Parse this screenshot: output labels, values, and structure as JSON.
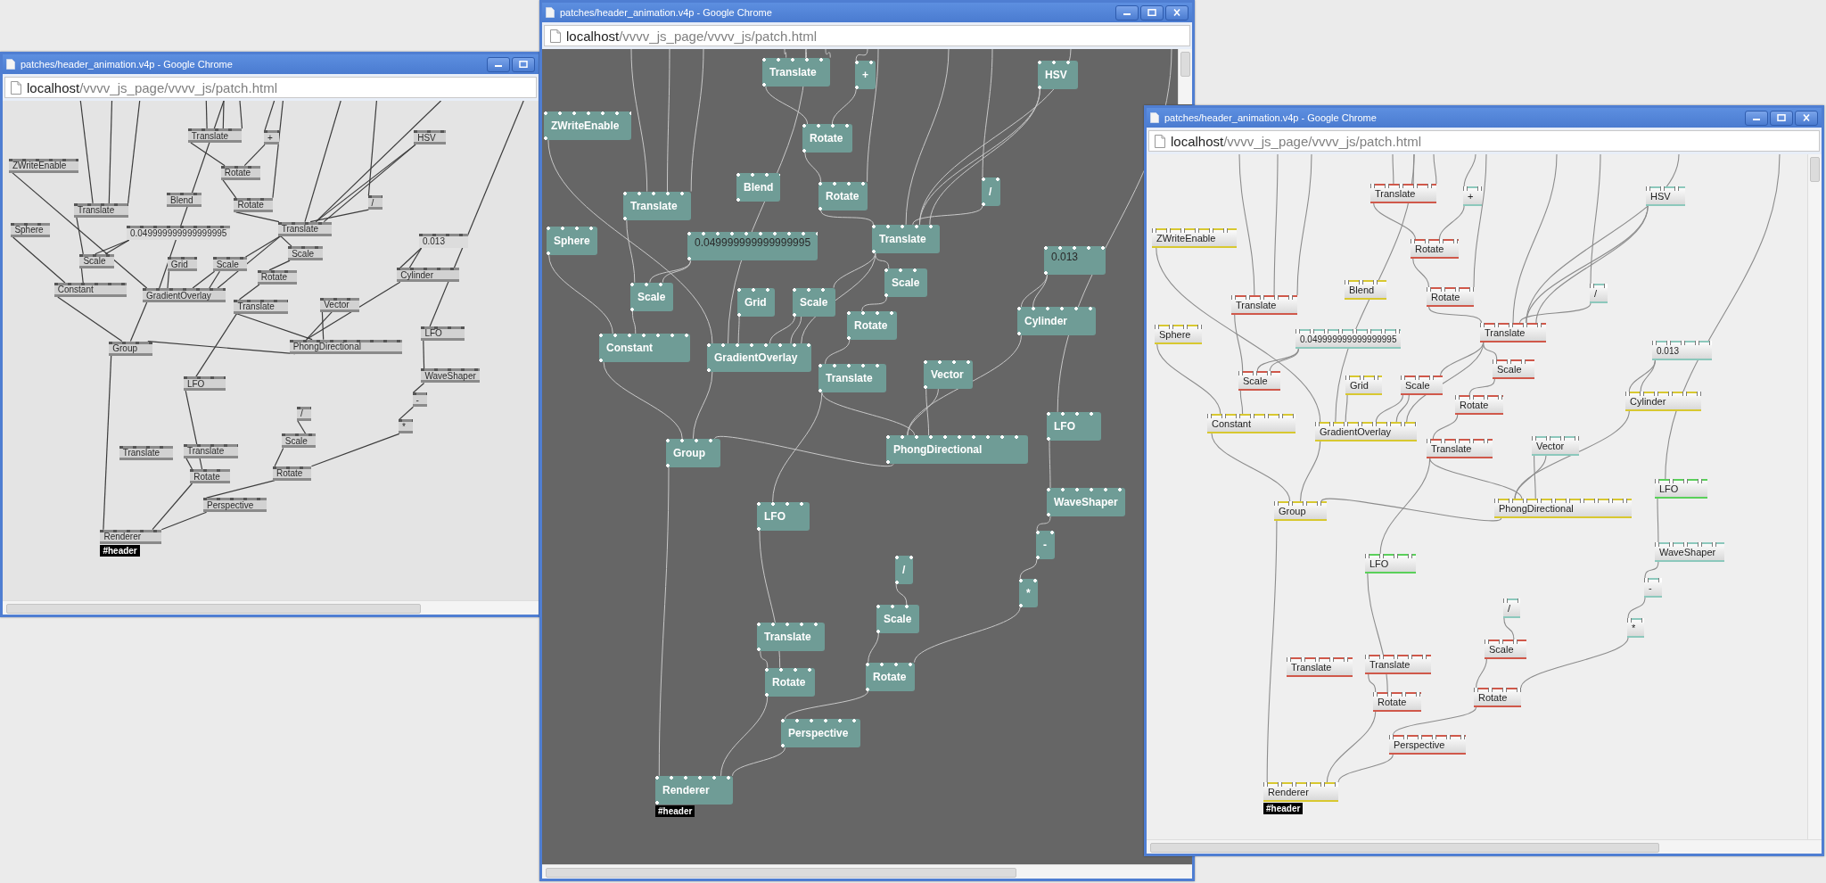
{
  "windows": [
    {
      "kind": "gray",
      "title": "patches/header_animation.v4p - Google Chrome",
      "controls": [
        {
          "kind": "minimize"
        },
        {
          "kind": "maximize"
        }
      ],
      "url": {
        "host": "localhost",
        "path": "/vvvv_js_page/vvvv_js/patch.html"
      },
      "nodes": [
        {
          "label": "Translate",
          "kind": "op"
        },
        {
          "label": "+",
          "kind": "op"
        },
        {
          "label": "HSV",
          "kind": "op"
        },
        {
          "label": "ZWriteEnable",
          "kind": "op"
        },
        {
          "label": "Rotate",
          "kind": "op"
        },
        {
          "label": "Blend",
          "kind": "op"
        },
        {
          "label": "Translate",
          "kind": "op"
        },
        {
          "label": "Rotate",
          "kind": "op"
        },
        {
          "label": "/",
          "kind": "op"
        },
        {
          "label": "Sphere",
          "kind": "op"
        },
        {
          "label": "0.049999999999999995",
          "kind": "value"
        },
        {
          "label": "Translate",
          "kind": "op"
        },
        {
          "label": "0.013",
          "kind": "value"
        },
        {
          "label": "Scale",
          "kind": "op"
        },
        {
          "label": "Grid",
          "kind": "op"
        },
        {
          "label": "Scale",
          "kind": "op"
        },
        {
          "label": "Scale",
          "kind": "op"
        },
        {
          "label": "Cylinder",
          "kind": "op"
        },
        {
          "label": "Rotate",
          "kind": "op"
        },
        {
          "label": "Constant",
          "kind": "op"
        },
        {
          "label": "GradientOverlay",
          "kind": "op"
        },
        {
          "label": "Translate",
          "kind": "op"
        },
        {
          "label": "Vector",
          "kind": "op"
        },
        {
          "label": "LFO",
          "kind": "op"
        },
        {
          "label": "Group",
          "kind": "op"
        },
        {
          "label": "PhongDirectional",
          "kind": "op"
        },
        {
          "label": "WaveShaper",
          "kind": "op"
        },
        {
          "label": "LFO",
          "kind": "op"
        },
        {
          "label": "-",
          "kind": "op"
        },
        {
          "label": "/",
          "kind": "op"
        },
        {
          "label": "*",
          "kind": "op"
        },
        {
          "label": "Scale",
          "kind": "op"
        },
        {
          "label": "Translate",
          "kind": "op"
        },
        {
          "label": "Translate",
          "kind": "op"
        },
        {
          "label": "Rotate",
          "kind": "op"
        },
        {
          "label": "Rotate",
          "kind": "op"
        },
        {
          "label": "Perspective",
          "kind": "op"
        },
        {
          "label": "Renderer",
          "kind": "op",
          "tag": "#header"
        }
      ]
    },
    {
      "kind": "dark",
      "title": "patches/header_animation.v4p - Google Chrome",
      "controls": [
        {
          "kind": "minimize"
        },
        {
          "kind": "maximize"
        },
        {
          "kind": "close"
        }
      ],
      "url": {
        "host": "localhost",
        "path": "/vvvv_js_page/vvvv_js/patch.html"
      },
      "nodes": [
        {
          "label": "Translate",
          "kind": "op"
        },
        {
          "label": "+",
          "kind": "op"
        },
        {
          "label": "HSV",
          "kind": "op"
        },
        {
          "label": "ZWriteEnable",
          "kind": "op"
        },
        {
          "label": "Rotate",
          "kind": "op"
        },
        {
          "label": "Blend",
          "kind": "op"
        },
        {
          "label": "Translate",
          "kind": "op"
        },
        {
          "label": "Rotate",
          "kind": "op"
        },
        {
          "label": "/",
          "kind": "op"
        },
        {
          "label": "Sphere",
          "kind": "op"
        },
        {
          "label": "0.049999999999999995",
          "kind": "value"
        },
        {
          "label": "Translate",
          "kind": "op"
        },
        {
          "label": "0.013",
          "kind": "value"
        },
        {
          "label": "Scale",
          "kind": "op"
        },
        {
          "label": "Grid",
          "kind": "op"
        },
        {
          "label": "Scale",
          "kind": "op"
        },
        {
          "label": "Scale",
          "kind": "op"
        },
        {
          "label": "Cylinder",
          "kind": "op"
        },
        {
          "label": "Rotate",
          "kind": "op"
        },
        {
          "label": "Constant",
          "kind": "op"
        },
        {
          "label": "GradientOverlay",
          "kind": "op"
        },
        {
          "label": "Translate",
          "kind": "op"
        },
        {
          "label": "Vector",
          "kind": "op"
        },
        {
          "label": "LFO",
          "kind": "op"
        },
        {
          "label": "Group",
          "kind": "op"
        },
        {
          "label": "PhongDirectional",
          "kind": "op"
        },
        {
          "label": "WaveShaper",
          "kind": "op"
        },
        {
          "label": "LFO",
          "kind": "op"
        },
        {
          "label": "-",
          "kind": "op"
        },
        {
          "label": "/",
          "kind": "op"
        },
        {
          "label": "*",
          "kind": "op"
        },
        {
          "label": "Scale",
          "kind": "op"
        },
        {
          "label": "Translate",
          "kind": "op"
        },
        {
          "label": "Rotate",
          "kind": "op"
        },
        {
          "label": "Rotate",
          "kind": "op"
        },
        {
          "label": "Perspective",
          "kind": "op"
        },
        {
          "label": "Renderer",
          "kind": "op",
          "tag": "#header"
        }
      ]
    },
    {
      "kind": "light",
      "title": "patches/header_animation.v4p - Google Chrome",
      "controls": [
        {
          "kind": "minimize"
        },
        {
          "kind": "maximize"
        },
        {
          "kind": "close"
        }
      ],
      "url": {
        "host": "localhost",
        "path": "/vvvv_js_page/vvvv_js/patch.html"
      },
      "nodes": [
        {
          "label": "Translate",
          "kind": "op",
          "color": "#d0584a"
        },
        {
          "label": "+",
          "kind": "op",
          "color": "#8cc8bc"
        },
        {
          "label": "HSV",
          "kind": "op",
          "color": "#8cc8bc"
        },
        {
          "label": "ZWriteEnable",
          "kind": "op",
          "color": "#d8c830"
        },
        {
          "label": "Rotate",
          "kind": "op",
          "color": "#d0584a"
        },
        {
          "label": "Blend",
          "kind": "op",
          "color": "#d8c830"
        },
        {
          "label": "Translate",
          "kind": "op",
          "color": "#d0584a"
        },
        {
          "label": "Rotate",
          "kind": "op",
          "color": "#d0584a"
        },
        {
          "label": "/",
          "kind": "op",
          "color": "#8cc8bc"
        },
        {
          "label": "Sphere",
          "kind": "op",
          "color": "#d8c830"
        },
        {
          "label": "0.049999999999999995",
          "kind": "value",
          "color": "#8cc8bc"
        },
        {
          "label": "Translate",
          "kind": "op",
          "color": "#d0584a"
        },
        {
          "label": "0.013",
          "kind": "value",
          "color": "#8cc8bc"
        },
        {
          "label": "Scale",
          "kind": "op",
          "color": "#d0584a"
        },
        {
          "label": "Grid",
          "kind": "op",
          "color": "#d8c830"
        },
        {
          "label": "Scale",
          "kind": "op",
          "color": "#d0584a"
        },
        {
          "label": "Scale",
          "kind": "op",
          "color": "#d0584a"
        },
        {
          "label": "Cylinder",
          "kind": "op",
          "color": "#d8c830"
        },
        {
          "label": "Rotate",
          "kind": "op",
          "color": "#d0584a"
        },
        {
          "label": "Constant",
          "kind": "op",
          "color": "#d8c830"
        },
        {
          "label": "GradientOverlay",
          "kind": "op",
          "color": "#d8c830"
        },
        {
          "label": "Translate",
          "kind": "op",
          "color": "#d0584a"
        },
        {
          "label": "Vector",
          "kind": "op",
          "color": "#8cc8bc"
        },
        {
          "label": "LFO",
          "kind": "op",
          "color": "#5ad05a"
        },
        {
          "label": "Group",
          "kind": "op",
          "color": "#d8c830"
        },
        {
          "label": "PhongDirectional",
          "kind": "op",
          "color": "#d8c830"
        },
        {
          "label": "WaveShaper",
          "kind": "op",
          "color": "#8cc8bc"
        },
        {
          "label": "LFO",
          "kind": "op",
          "color": "#5ad05a"
        },
        {
          "label": "-",
          "kind": "op",
          "color": "#8cc8bc"
        },
        {
          "label": "/",
          "kind": "op",
          "color": "#8cc8bc"
        },
        {
          "label": "*",
          "kind": "op",
          "color": "#8cc8bc"
        },
        {
          "label": "Scale",
          "kind": "op",
          "color": "#d0584a"
        },
        {
          "label": "Translate",
          "kind": "op",
          "color": "#d0584a"
        },
        {
          "label": "Translate",
          "kind": "op",
          "color": "#d0584a"
        },
        {
          "label": "Rotate",
          "kind": "op",
          "color": "#d0584a"
        },
        {
          "label": "Rotate",
          "kind": "op",
          "color": "#d0584a"
        },
        {
          "label": "Perspective",
          "kind": "op",
          "color": "#d0584a"
        },
        {
          "label": "Renderer",
          "kind": "op",
          "color": "#d8c830",
          "tag": "#header"
        }
      ]
    }
  ]
}
